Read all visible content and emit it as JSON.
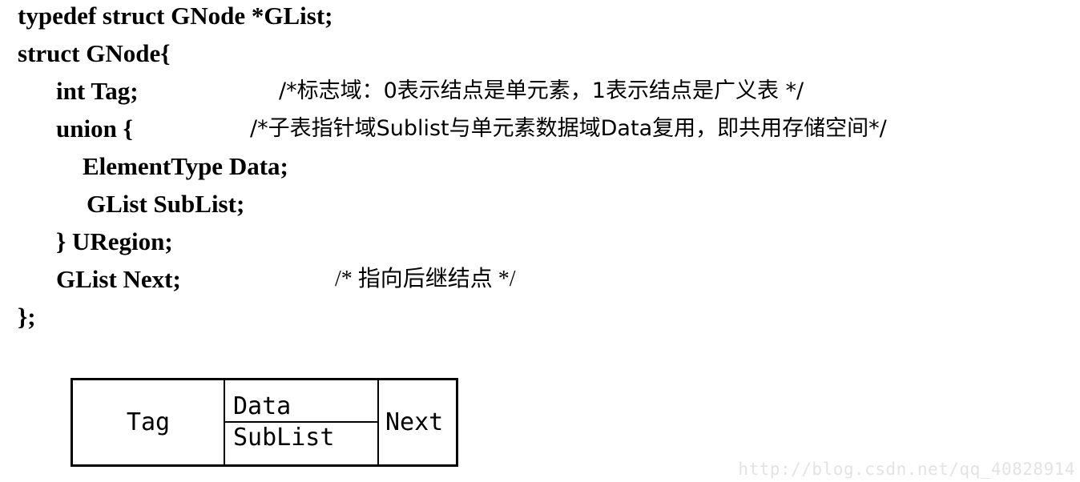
{
  "document": {
    "title": "typedef struct GNode *GList;",
    "language": "C"
  },
  "code": {
    "lines": [
      {
        "text": "typedef struct GNode *GList;",
        "comment": ""
      },
      {
        "text": "struct GNode{",
        "comment": ""
      },
      {
        "text": "int Tag;",
        "comment": "/*标志域：0表示结点是单元素，1表示结点是广义表 */"
      },
      {
        "text": "union {",
        "comment": "/*子表指针域Sublist与单元素数据域Data复用，即共用存储空间*/"
      },
      {
        "text": "ElementType    Data;",
        "comment": ""
      },
      {
        "text": "GList  SubList;",
        "comment": ""
      },
      {
        "text": "} URegion;",
        "comment": ""
      },
      {
        "text": "GList Next;",
        "comment": "/* 指向后继结点 */"
      },
      {
        "text": "};",
        "comment": ""
      }
    ]
  },
  "diagram": {
    "name": "gnode-structure-box",
    "cells": {
      "tag": "Tag",
      "data": "Data",
      "sublist": "SubList",
      "next": "Next"
    }
  },
  "watermark": {
    "text": "http://blog.csdn.net/qq_40828914",
    "color": "#e3e3e3"
  }
}
